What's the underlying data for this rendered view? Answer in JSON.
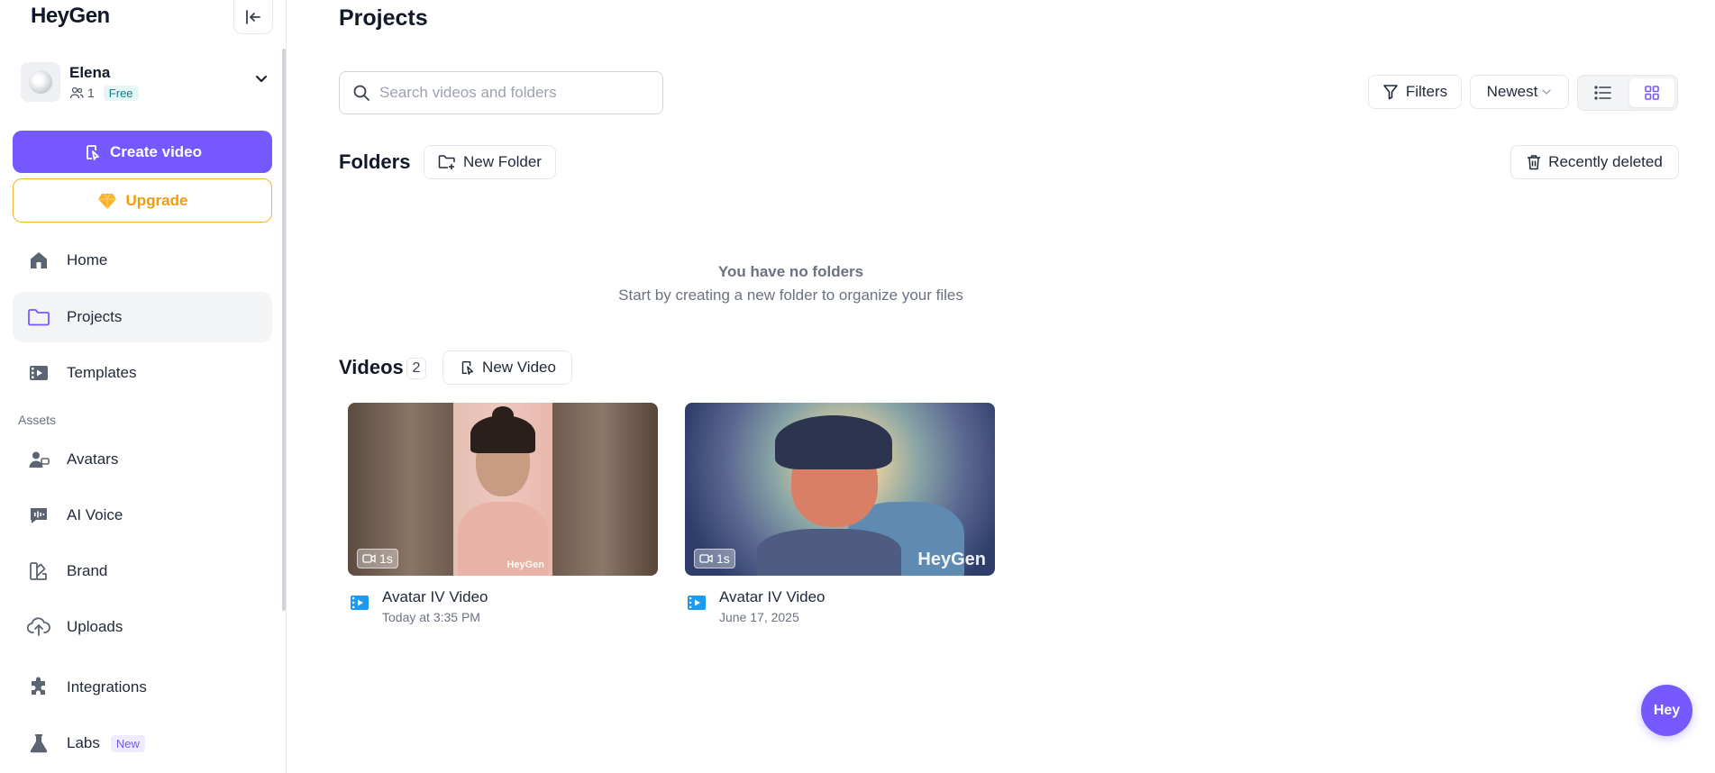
{
  "app": {
    "logo_text": "HeyGen"
  },
  "account": {
    "name": "Elena",
    "members": "1",
    "plan": "Free"
  },
  "sidebar": {
    "create_label": "Create video",
    "upgrade_label": "Upgrade",
    "items": [
      {
        "label": "Home",
        "icon": "home-icon"
      },
      {
        "label": "Projects",
        "icon": "folder-icon",
        "active": true
      },
      {
        "label": "Templates",
        "icon": "film-icon"
      }
    ],
    "assets_label": "Assets",
    "asset_items": [
      {
        "label": "Avatars",
        "icon": "avatar-icon"
      },
      {
        "label": "AI Voice",
        "icon": "voice-icon"
      },
      {
        "label": "Brand",
        "icon": "brand-icon"
      },
      {
        "label": "Uploads",
        "icon": "upload-icon"
      },
      {
        "label": "Integrations",
        "icon": "puzzle-icon"
      },
      {
        "label": "Labs",
        "icon": "flask-icon",
        "badge": "New"
      }
    ]
  },
  "main": {
    "title": "Projects",
    "search_placeholder": "Search videos and folders",
    "filters_label": "Filters",
    "sort_label": "Newest",
    "view_mode": "grid",
    "folders": {
      "title": "Folders",
      "new_label": "New Folder",
      "deleted_label": "Recently deleted",
      "empty_title": "You have no folders",
      "empty_sub": "Start by creating a new folder to organize your files"
    },
    "videos": {
      "title": "Videos",
      "count": "2",
      "new_label": "New Video",
      "items": [
        {
          "title": "Avatar IV Video",
          "date": "Today at 3:35 PM",
          "duration": "1s",
          "watermark": "HeyGen"
        },
        {
          "title": "Avatar IV Video",
          "date": "June 17, 2025",
          "duration": "1s",
          "watermark": "HeyGen"
        }
      ]
    },
    "chat_label": "Hey"
  },
  "colors": {
    "accent": "#7559ff",
    "upgrade": "#f29b0c",
    "video_icon": "#1d9bf0"
  }
}
